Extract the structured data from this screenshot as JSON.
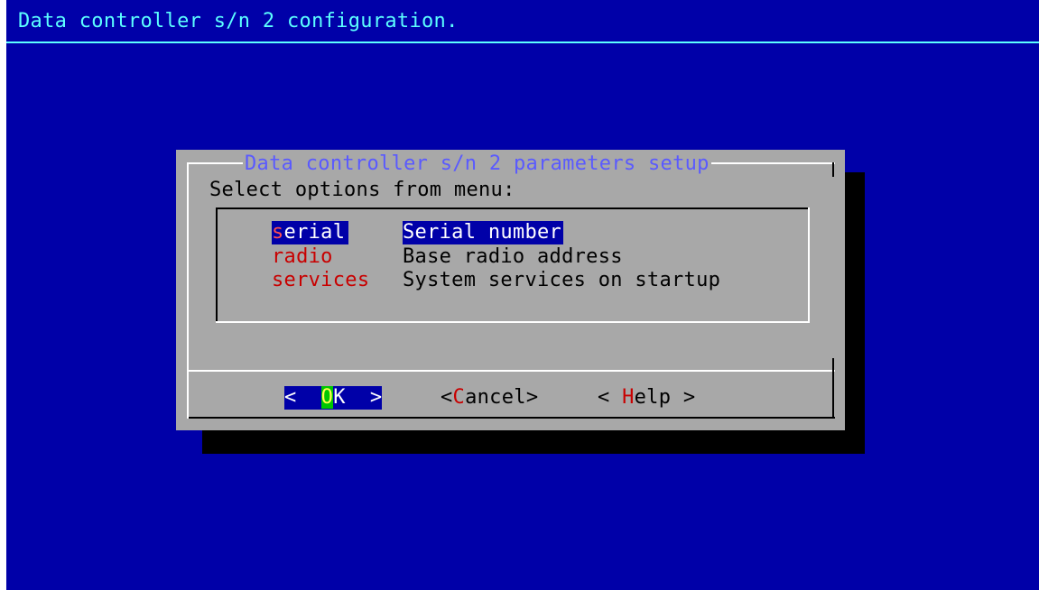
{
  "backtitle": "Data controller s/n 2 configuration.",
  "dialog": {
    "title": "Data controller s/n 2 parameters setup",
    "prompt": "Select options from menu:",
    "menu": [
      {
        "tag_first": "s",
        "tag_rest": "erial",
        "description": "Serial number",
        "selected": true
      },
      {
        "tag_first": "r",
        "tag_rest": "adio",
        "description": "Base radio address",
        "selected": false
      },
      {
        "tag_first": "s",
        "tag_rest": "ervices",
        "description": "System services on startup",
        "selected": false
      }
    ],
    "buttons": {
      "ok": {
        "left": "<  ",
        "hot": "O",
        "rest": "K  >"
      },
      "cancel": {
        "left": "<",
        "hot": "C",
        "rest": "ancel>"
      },
      "help": {
        "left": "< ",
        "hot": "H",
        "rest": "elp >"
      }
    }
  },
  "colors": {
    "background": "#0000a8",
    "backtitle": "#5cffff",
    "dialog": "#a8a8a8",
    "dialog_title": "#5a5aff",
    "hotkey": "#c80000",
    "selected_bg": "#0000a8",
    "ok_hotkey_bg": "#00c800",
    "ok_hotkey_fg": "#ffff50"
  }
}
